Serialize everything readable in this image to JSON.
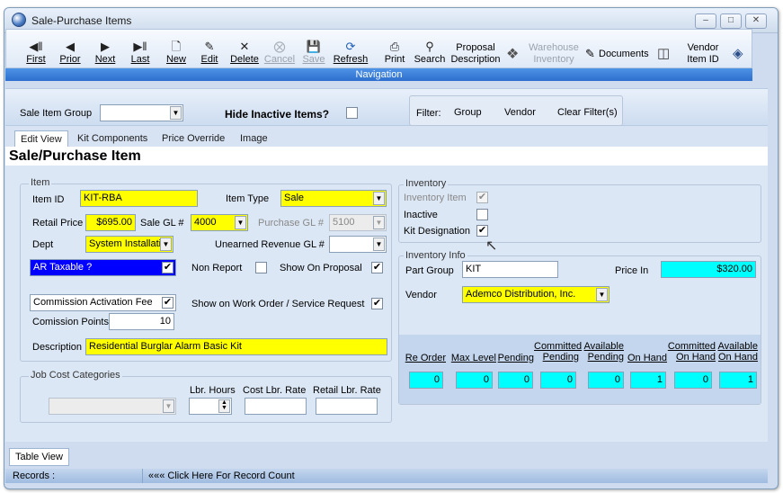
{
  "window": {
    "title": "Sale-Purchase Items"
  },
  "toolbar": {
    "first": "First",
    "prior": "Prior",
    "next": "Next",
    "last": "Last",
    "new": "New",
    "edit": "Edit",
    "delete": "Delete",
    "cancel": "Cancel",
    "save": "Save",
    "refresh": "Refresh",
    "print": "Print",
    "search": "Search",
    "proposal_line1": "Proposal",
    "proposal_line2": "Description",
    "warehouse_line1": "Warehouse",
    "warehouse_line2": "Inventory",
    "documents": "Documents",
    "vendor_line1": "Vendor",
    "vendor_line2": "Item ID",
    "section_label": "Navigation"
  },
  "filter_bar": {
    "sale_item_group_label": "Sale Item Group",
    "sale_item_group_value": "",
    "hide_inactive_label": "Hide Inactive Items?",
    "filter_label": "Filter:",
    "group": "Group",
    "vendor": "Vendor",
    "clear": "Clear Filter(s)"
  },
  "tabs": [
    "Edit View",
    "Kit Components",
    "Price Override",
    "Image"
  ],
  "page_title": "Sale/Purchase Item",
  "item": {
    "group_label": "Item",
    "item_id_label": "Item ID",
    "item_id": "KIT-RBA",
    "item_type_label": "Item Type",
    "item_type": "Sale",
    "retail_price_label": "Retail Price",
    "retail_price": "$695.00",
    "sale_gl_label": "Sale GL #",
    "sale_gl": "4000",
    "purchase_gl_label": "Purchase GL #",
    "purchase_gl": "5100",
    "dept_label": "Dept",
    "dept": "System Installati",
    "unearned_label": "Unearned Revenue GL #",
    "unearned": "",
    "ar_taxable_label": "AR Taxable ?",
    "non_report_label": "Non Report",
    "show_on_proposal_label": "Show On Proposal",
    "commission_activation_label": "Commission Activation Fee",
    "show_on_wo_label": "Show on Work Order / Service Request",
    "commission_points_label": "Comission Points",
    "commission_points": "10",
    "description_label": "Description",
    "description": "Residential Burglar Alarm Basic Kit"
  },
  "job_cost": {
    "group_label": "Job Cost Categories",
    "lbr_hours_label": "Lbr. Hours",
    "cost_rate_label": "Cost Lbr. Rate",
    "retail_rate_label": "Retail Lbr. Rate"
  },
  "inventory": {
    "group_label": "Inventory",
    "inventory_item_label": "Inventory Item",
    "inactive_label": "Inactive",
    "kit_designation_label": "Kit Designation"
  },
  "inventory_info": {
    "group_label": "Inventory Info",
    "part_group_label": "Part Group",
    "part_group": "KIT",
    "price_in_label": "Price In",
    "price_in": "$320.00",
    "vendor_label": "Vendor",
    "vendor": "Ademco Distribution, Inc.",
    "columns": [
      {
        "line1": "",
        "line2": "Re Order",
        "value": "0"
      },
      {
        "line1": "",
        "line2": "Max Level",
        "value": "0"
      },
      {
        "line1": "",
        "line2": "Pending",
        "value": "0"
      },
      {
        "line1": "Committed",
        "line2": "Pending",
        "value": "0"
      },
      {
        "line1": "Available",
        "line2": "Pending",
        "value": "0"
      },
      {
        "line1": "",
        "line2": "On Hand",
        "value": "1"
      },
      {
        "line1": "Committed",
        "line2": "On Hand",
        "value": "0"
      },
      {
        "line1": "Available",
        "line2": "On Hand",
        "value": "1"
      }
    ]
  },
  "bottom": {
    "table_view_tab": "Table View",
    "records_label": "Records :",
    "record_count_link": "««« Click Here For Record Count"
  }
}
